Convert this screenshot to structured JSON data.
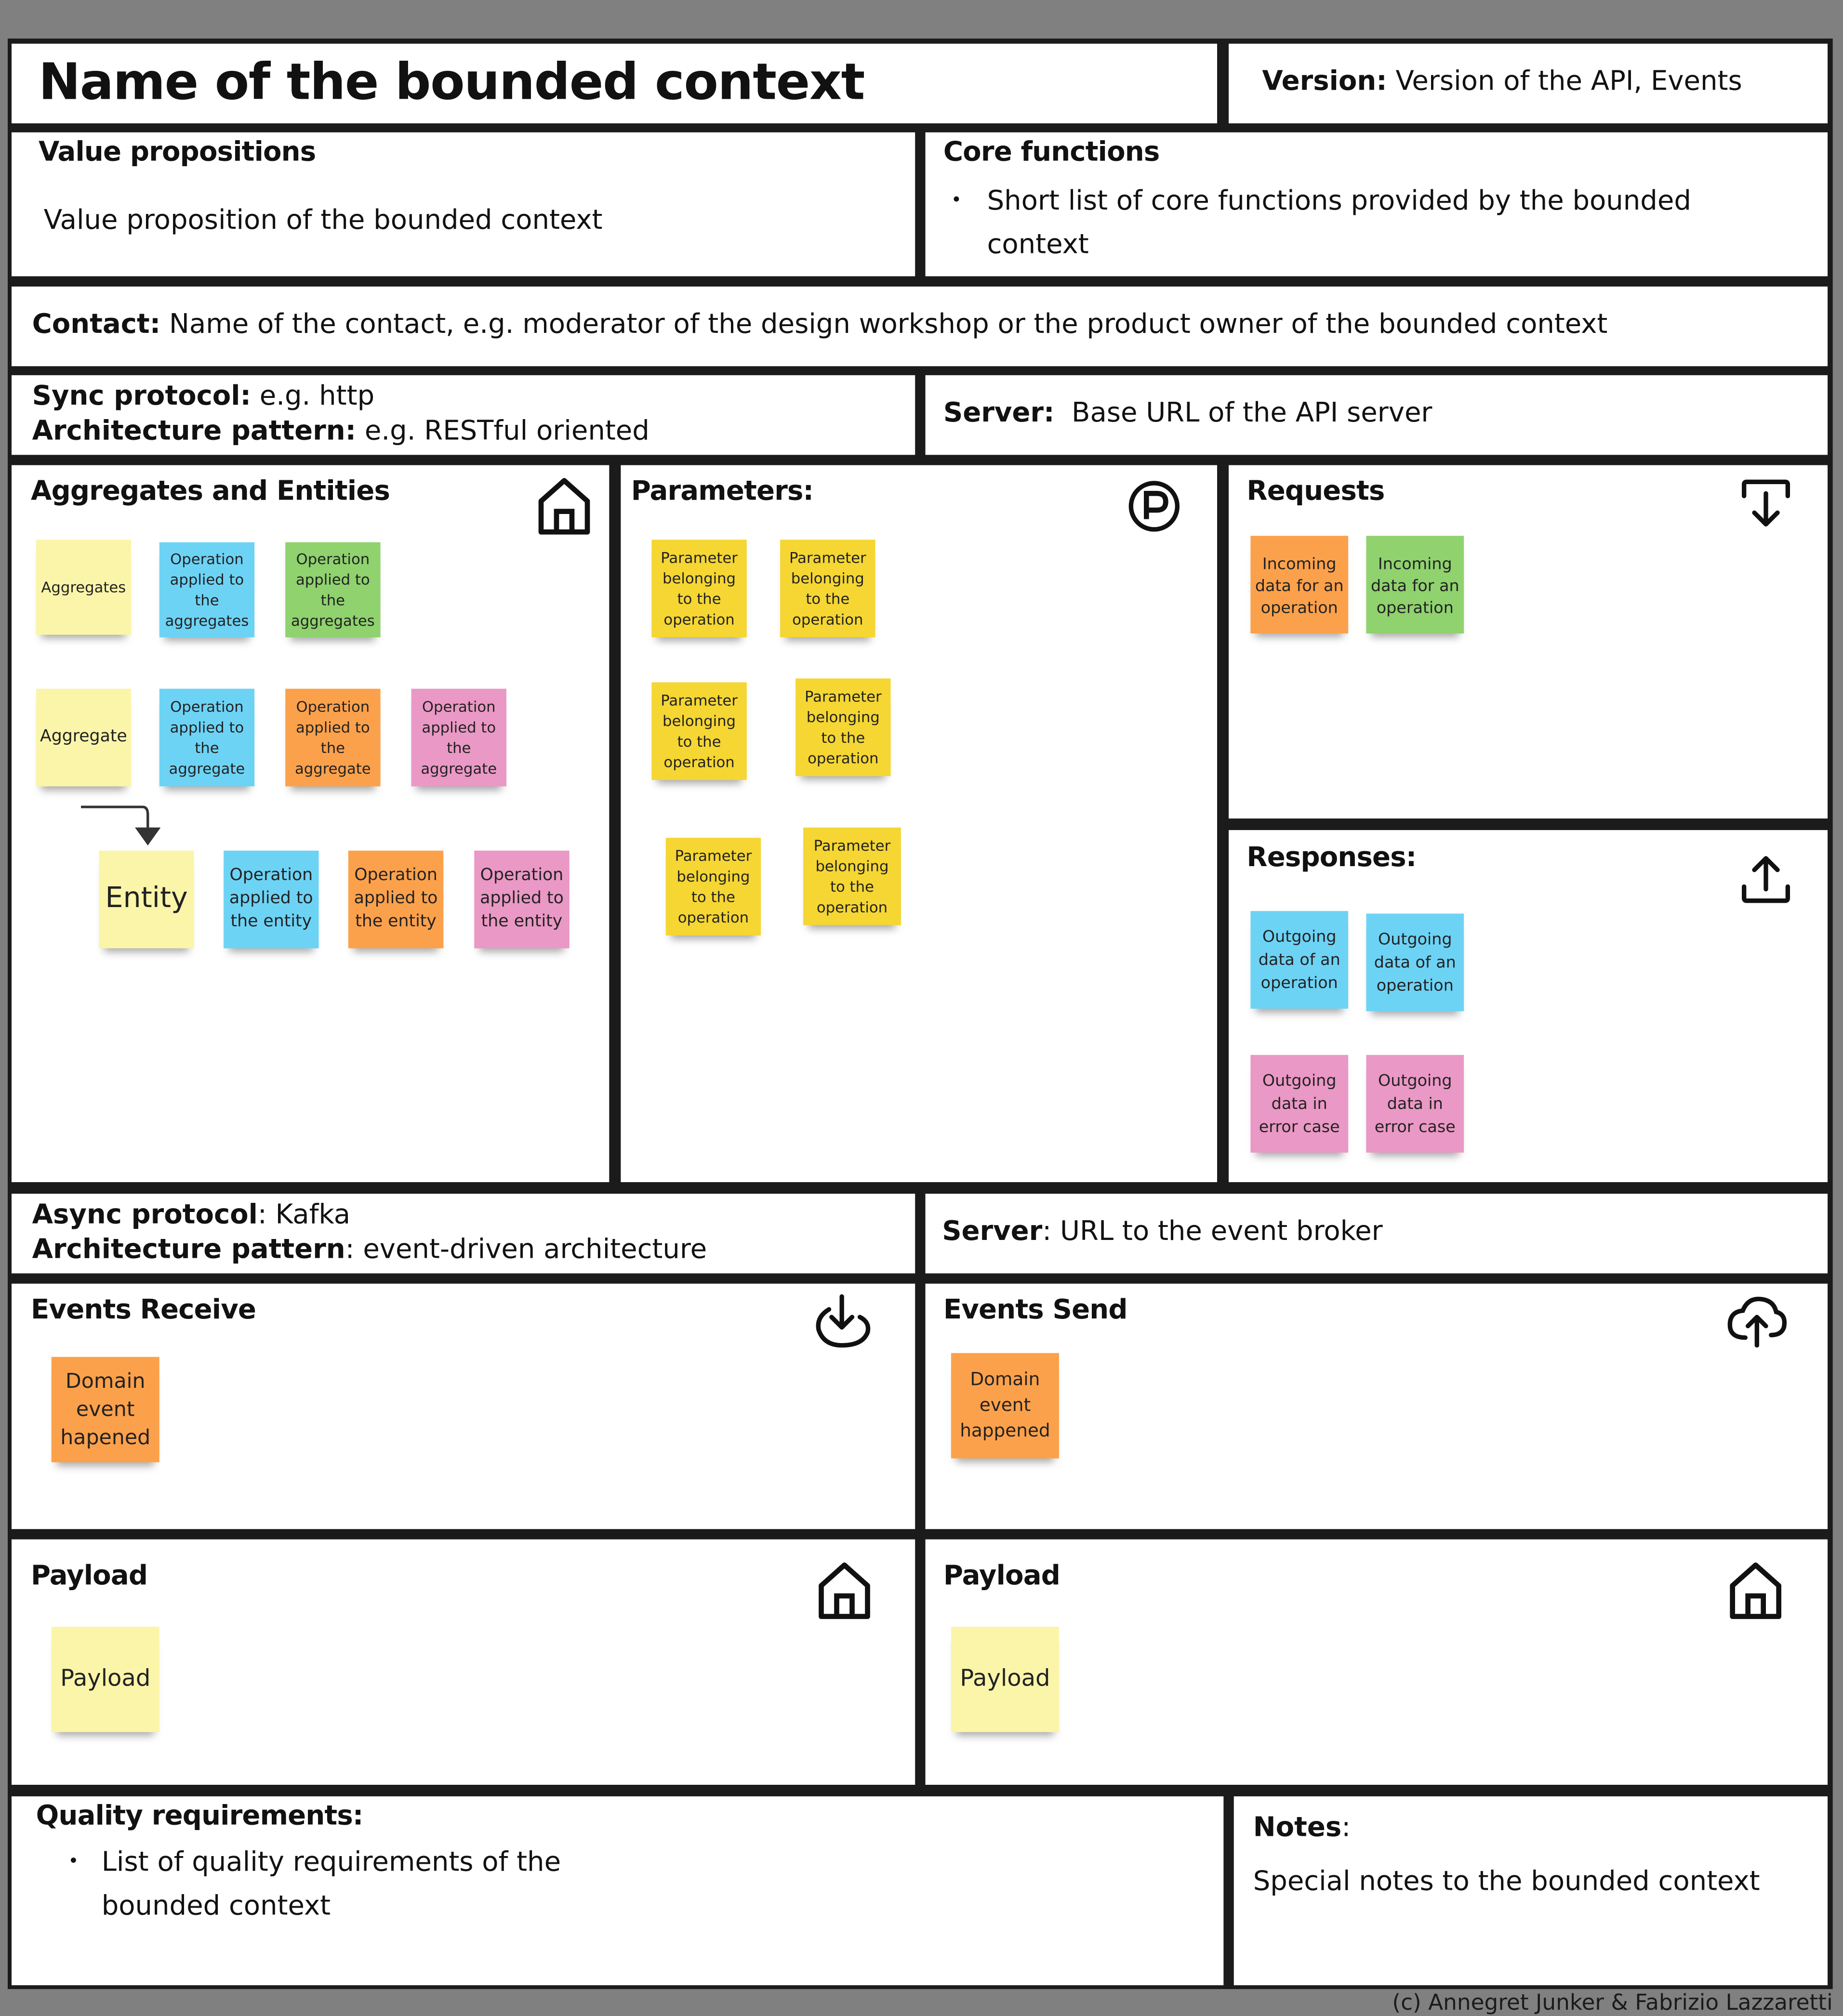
{
  "title": "Name of the bounded context",
  "version": {
    "label": "Version:",
    "value": "Version of the API, Events"
  },
  "value_propositions": {
    "heading": "Value propositions",
    "text": "Value proposition of the bounded context"
  },
  "core_functions": {
    "heading": "Core functions",
    "items": [
      "Short list of core functions provided by the bounded context"
    ]
  },
  "contact": {
    "label": "Contact:",
    "value": "Name of the contact, e.g. moderator of the design workshop or the product owner of the bounded context"
  },
  "sync": {
    "protocol_label": "Sync protocol:",
    "protocol_value": "e.g. http",
    "pattern_label": "Architecture pattern:",
    "pattern_value": "e.g. RESTful oriented"
  },
  "sync_server": {
    "label": "Server:",
    "value": "Base URL of the API server"
  },
  "aggregates": {
    "heading": "Aggregates and Entities",
    "icon": "house-icon",
    "row1": [
      "Aggregates",
      "Operation applied to the aggregates",
      "Operation applied to the aggregates"
    ],
    "row2": [
      "Aggregate",
      "Operation applied to the aggregate",
      "Operation applied to the aggregate",
      "Operation applied to the aggregate"
    ],
    "row3": [
      "Entity",
      "Operation applied to the entity",
      "Operation applied to the entity",
      "Operation applied to the entity"
    ]
  },
  "parameters": {
    "heading": "Parameters:",
    "icon": "parking-p-icon",
    "notes": [
      "Parameter belonging to the operation",
      "Parameter belonging to the operation",
      "Parameter belonging to the operation",
      "Parameter belonging to the operation",
      "Parameter belonging to the operation",
      "Parameter belonging to the operation"
    ]
  },
  "requests": {
    "heading": "Requests",
    "icon": "download-tray-icon",
    "notes": [
      "Incoming data for an operation",
      "Incoming data for an operation"
    ]
  },
  "responses": {
    "heading": "Responses:",
    "icon": "upload-tray-icon",
    "notes": [
      "Outgoing data of an operation",
      "Outgoing data of an operation",
      "Outgoing data in error case",
      "Outgoing data in error case"
    ]
  },
  "async": {
    "protocol_label": "Async protocol",
    "protocol_value": ": Kafka",
    "pattern_label": "Architecture pattern",
    "pattern_value": ": event-driven architecture"
  },
  "async_server": {
    "label": "Server",
    "value": ": URL to the event broker"
  },
  "events_receive": {
    "heading": "Events Receive",
    "icon": "cloud-download-icon",
    "note": "Domain event hapened"
  },
  "events_send": {
    "heading": "Events Send",
    "icon": "cloud-upload-icon",
    "note": "Domain event happened"
  },
  "payload_left": {
    "heading": "Payload",
    "icon": "house-icon",
    "note": "Payload"
  },
  "payload_right": {
    "heading": "Payload",
    "icon": "house-icon",
    "note": "Payload"
  },
  "quality": {
    "heading": "Quality requirements:",
    "items": [
      "List of quality requirements of the bounded context"
    ]
  },
  "notes": {
    "heading": "Notes",
    "colon": ":",
    "text": "Special notes to the bounded context"
  },
  "copyright": "(c) Annegret Junker & Fabrizio Lazzaretti"
}
